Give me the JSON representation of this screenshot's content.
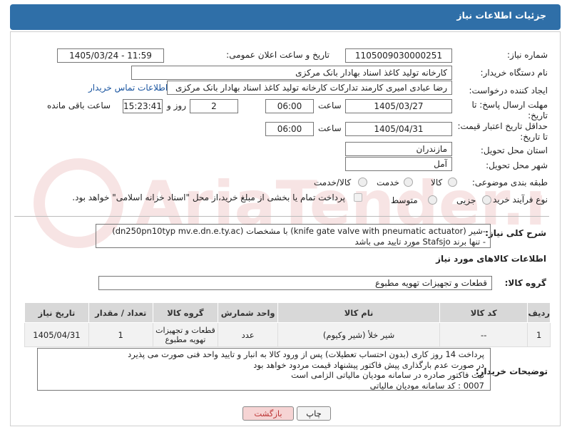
{
  "header": {
    "title": "جزئیات اطلاعات نیاز"
  },
  "form": {
    "need_number_label": "شماره نیاز:",
    "need_number": "1105009030000251",
    "announce_label": "تاریخ و ساعت اعلان عمومی:",
    "announce_value": "1405/03/24 - 11:59",
    "buyer_org_label": "نام دستگاه خریدار:",
    "buyer_org": "کارخانه تولید کاغذ اسناد بهادار بانک مرکزی",
    "creator_label": "ایجاد کننده درخواست:",
    "creator": "رضا عبادی امیری کارمند تدارکات کارخانه تولید کاغذ اسناد بهادار بانک مرکزی",
    "contact_link": "اطلاعات تماس خریدار",
    "reply_deadline_label": "مهلت ارسال پاسخ: تا تاریخ:",
    "reply_date": "1405/03/27",
    "time_word": "ساعت",
    "reply_time": "06:00",
    "days_value": "2",
    "days_word": "روز و",
    "remaining_time": "15:23:41",
    "remaining_word": "ساعت باقی مانده",
    "price_validity_label": "حداقل تاریخ اعتبار قیمت: تا تاریخ:",
    "price_date": "1405/04/31",
    "price_time": "06:00",
    "province_label": "استان محل تحویل:",
    "province": "مازندران",
    "city_label": "شهر محل تحویل:",
    "city": "آمل",
    "category_label": "طبقه بندی موضوعی:",
    "category_options": [
      "کالا",
      "خدمت",
      "کالا/خدمت"
    ],
    "process_label": "نوع فرآیند خرید :",
    "process_options": [
      "جزیی",
      "متوسط"
    ],
    "payment_note": "پرداخت تمام یا بخشی از مبلغ خرید،از محل \"اسناد خزانه اسلامی\" خواهد بود."
  },
  "description": {
    "label": "شرح کلی نیاز:",
    "line1": "-شیر (knife gate valve with pneumatic  actuator) با مشخصات (dn250pn10typ mv.e.dn.e.ty.ac)",
    "line2": "- تنها برند Stafsjo مورد تایید می باشد"
  },
  "goods_info_title": "اطلاعات کالاهای مورد نیاز",
  "goods_group": {
    "label": "گروه کالا:",
    "value": "قطعات و تجهیزات تهویه مطبوع"
  },
  "table": {
    "headers": [
      "ردیف",
      "کد کالا",
      "نام کالا",
      "واحد شمارش",
      "گروه کالا",
      "تعداد / مقدار",
      "تاریخ نیاز"
    ],
    "rows": [
      [
        "1",
        "--",
        "شیر خلأ (شیر وکیوم)",
        "عدد",
        "قطعات و تجهیزات تهویه مطبوع",
        "1",
        "1405/04/31"
      ]
    ]
  },
  "buyer_notes": {
    "label": "توضیحات خریدار:",
    "lines": [
      "پرداخت 14 روز کاری (بدون احتساب تعطیلات) پس از ورود کالا به انبار و تایید واحد فنی صورت می پذیرد",
      "در صورت عدم بارگذاری پیش فاکتور پیشنهاد قیمت مردود خواهد بود",
      "ثبت فاکتور صادره در سامانه مودیان مالیاتی الزامی است",
      "0007 : کد سامانه مودیان مالیاتی"
    ]
  },
  "buttons": {
    "print": "چاپ",
    "back": "بازگشت"
  },
  "watermark_text": "AriaTender.neT",
  "colors": {
    "header": "#2f6fa8",
    "link": "#1a55a0",
    "back_btn": "#f6d4d4"
  }
}
